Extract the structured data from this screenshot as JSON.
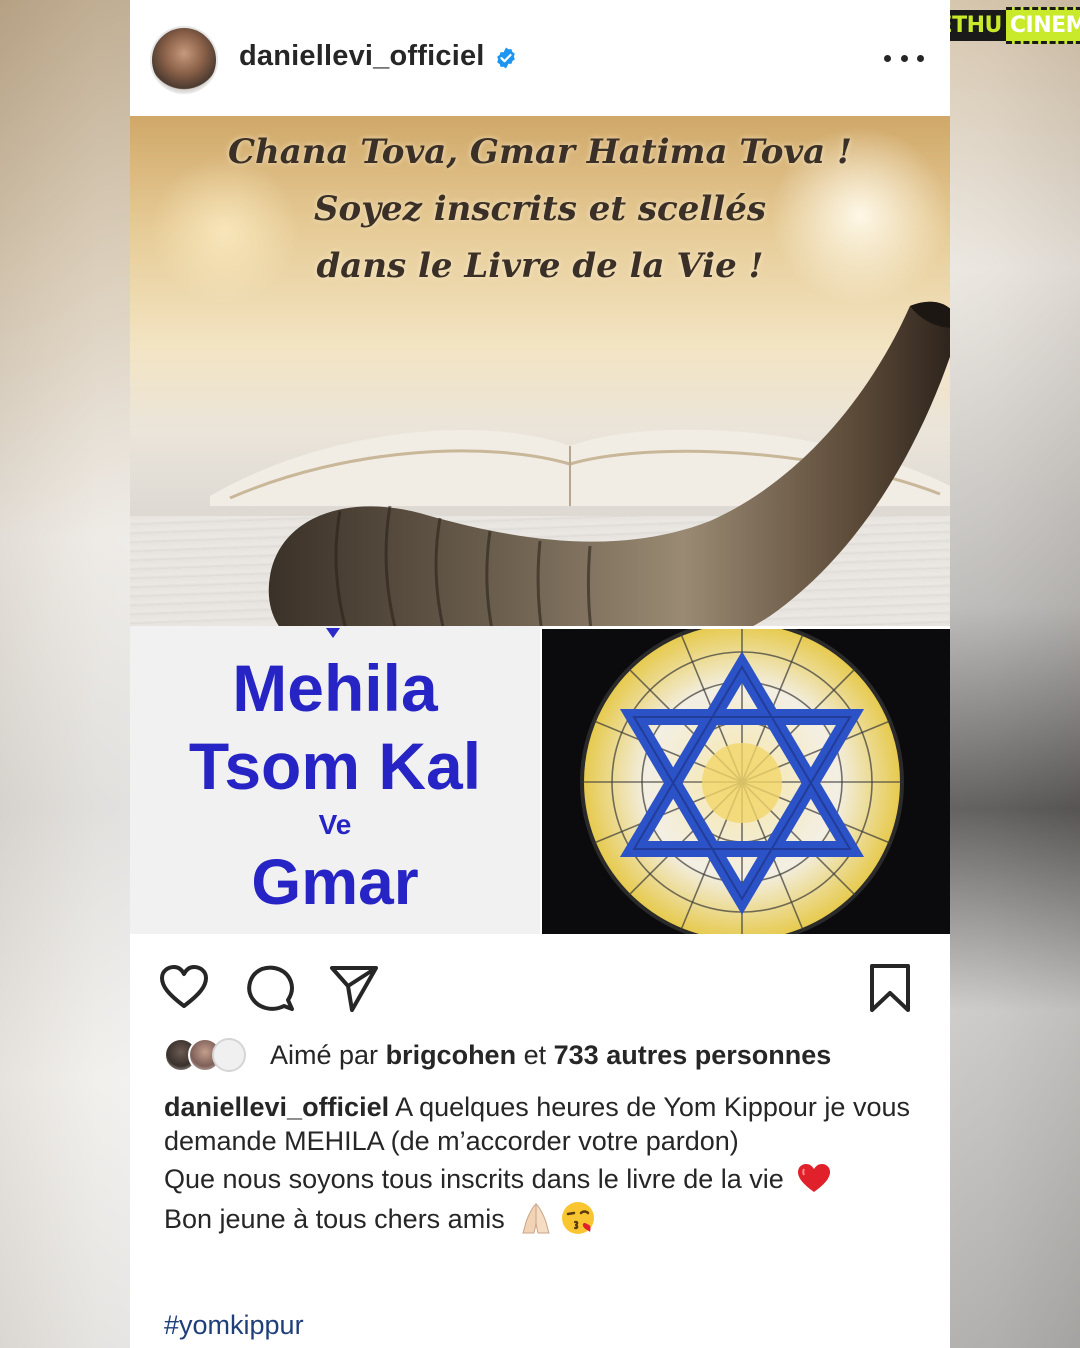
{
  "watermark": {
    "brand_a": "GETHU",
    "brand_b": "CINEMA"
  },
  "header": {
    "username": "daniellevi_officiel",
    "verified": true,
    "more_icon": "more-horizontal-icon"
  },
  "image_top": {
    "lines": [
      "Chana Tova, Gmar Hatima Tova !",
      "Soyez inscrits et scellés",
      "dans le Livre de la Vie !"
    ]
  },
  "image_bottom_left": {
    "line1": "Mehila",
    "line2": "Tsom Kal",
    "line3": "Ve",
    "line4": "Gmar"
  },
  "actions": {
    "like_icon": "heart-icon",
    "comment_icon": "comment-icon",
    "share_icon": "send-icon",
    "save_icon": "bookmark-icon"
  },
  "likes": {
    "prefix": "Aimé par",
    "user": "brigcohen",
    "connector": "et",
    "others": "733 autres personnes"
  },
  "caption": {
    "username": "daniellevi_officiel",
    "text1": " A quelques heures de Yom Kippour je vous demande MEHILA (de  m’accorder votre pardon)",
    "text2": "Que nous soyons tous inscrits dans le livre de la vie",
    "text3": "Bon jeune à tous chers amis",
    "hashtag": "#yomkippur"
  },
  "colors": {
    "accent_blue": "#2724c6",
    "verified_blue": "#1e95f1",
    "hashtag": "#1f3f7a",
    "text": "#262626"
  }
}
